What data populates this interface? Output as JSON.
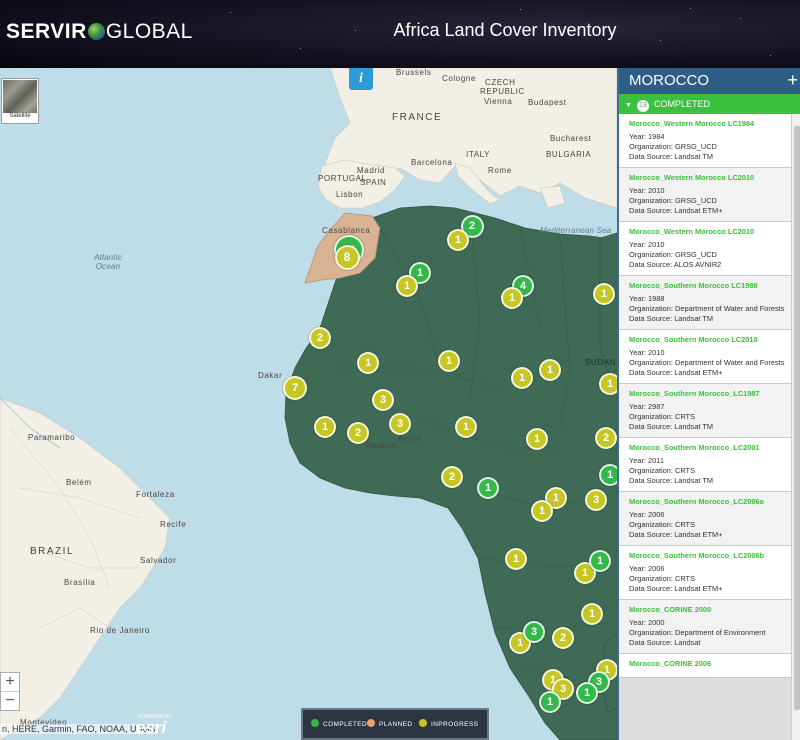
{
  "header": {
    "logo_part1": "SERVIR",
    "logo_part2": "GLOBAL",
    "title": "Africa Land Cover Inventory"
  },
  "map": {
    "satellite_label": "Satellite",
    "info_label": "i",
    "zoom_in": "+",
    "zoom_out": "−",
    "attribution": "ri, HERE, Garmin, FAO, NOAA, USGS",
    "powered_by": "POWERED BY",
    "esri_label": "esri",
    "labels": {
      "france": "FRANCE",
      "italy": "ITALY",
      "spain": "SPAIN",
      "portugal": "PORTUGAL",
      "bulgaria": "BULGARIA",
      "czech": "CZECH",
      "republic": "REPUBLIC",
      "brussels": "Brussels",
      "cologne": "Cologne",
      "vienna": "Vienna",
      "budapest": "Budapest",
      "bucharest": "Bucharest",
      "barcelona": "Barcelona",
      "madrid": "Madrid",
      "lisbon": "Lisbon",
      "casablanca": "Casablanca",
      "rome": "Rome",
      "dakar": "Dakar",
      "abidjan": "Abidjan",
      "accra": "Accra",
      "mediterranean": "Mediterranean Sea",
      "atlantic": "Atlantic Ocean",
      "brazil": "BRAZIL",
      "salvador": "Salvador",
      "fortaleza": "Fortaleza",
      "recife": "Recife",
      "belem": "Belém",
      "paramaribo": "Paramaribo",
      "brasilia": "Brasília",
      "rio": "Rio de Janeiro",
      "montevideo": "Montevideo",
      "sudan": "SUDAN"
    }
  },
  "clusters": [
    {
      "label": "13",
      "status": "completed"
    },
    {
      "label": "8",
      "status": "inprogress"
    },
    {
      "label": "2",
      "status": "completed"
    },
    {
      "label": "1",
      "status": "inprogress"
    },
    {
      "label": "1",
      "status": "completed"
    },
    {
      "label": "1",
      "status": "inprogress"
    },
    {
      "label": "4",
      "status": "completed"
    },
    {
      "label": "1",
      "status": "inprogress"
    },
    {
      "label": "1",
      "status": "inprogress"
    },
    {
      "label": "2",
      "status": "inprogress"
    },
    {
      "label": "1",
      "status": "inprogress"
    },
    {
      "label": "1",
      "status": "inprogress"
    },
    {
      "label": "1",
      "status": "inprogress"
    },
    {
      "label": "1",
      "status": "inprogress"
    },
    {
      "label": "7",
      "status": "inprogress"
    },
    {
      "label": "1",
      "status": "inprogress"
    },
    {
      "label": "3",
      "status": "inprogress"
    },
    {
      "label": "3",
      "status": "inprogress"
    },
    {
      "label": "1",
      "status": "inprogress"
    },
    {
      "label": "2",
      "status": "inprogress"
    },
    {
      "label": "1",
      "status": "inprogress"
    },
    {
      "label": "1",
      "status": "inprogress"
    },
    {
      "label": "2",
      "status": "inprogress"
    },
    {
      "label": "2",
      "status": "inprogress"
    },
    {
      "label": "1",
      "status": "completed"
    },
    {
      "label": "1",
      "status": "inprogress"
    },
    {
      "label": "3",
      "status": "inprogress"
    },
    {
      "label": "1",
      "status": "inprogress"
    },
    {
      "label": "1",
      "status": "completed"
    },
    {
      "label": "1",
      "status": "inprogress"
    },
    {
      "label": "1",
      "status": "inprogress"
    },
    {
      "label": "1",
      "status": "completed"
    },
    {
      "label": "1",
      "status": "inprogress"
    },
    {
      "label": "2",
      "status": "inprogress"
    },
    {
      "label": "1",
      "status": "inprogress"
    },
    {
      "label": "3",
      "status": "completed"
    },
    {
      "label": "1",
      "status": "inprogress"
    },
    {
      "label": "1",
      "status": "inprogress"
    },
    {
      "label": "3",
      "status": "completed"
    },
    {
      "label": "1",
      "status": "completed"
    },
    {
      "label": "3",
      "status": "inprogress"
    },
    {
      "label": "1",
      "status": "completed"
    }
  ],
  "legend": {
    "completed": "COMPLETED",
    "planned": "PLANNED",
    "inprogress": "INPROGRESS"
  },
  "colors": {
    "completed": "#35b84a",
    "planned": "#e8a06c",
    "inprogress": "#c6c625",
    "region": "#3f6b56",
    "morocco": "#d9b494"
  },
  "panel": {
    "country": "MOROCCO",
    "add_label": "+",
    "status_label": "COMPLETED",
    "status_count": "13",
    "items": [
      {
        "title": "Morocco_Western Morocco LC1984",
        "year": "Year: 1984",
        "org": "Organization: GRSG_UCD",
        "source": "Data Source: Landsat TM"
      },
      {
        "title": "Morocco_Western Morocco LC2010",
        "year": "Year: 2010",
        "org": "Organization: GRSG_UCD",
        "source": "Data Source: Landsat ETM+"
      },
      {
        "title": "Morocco_Western Morocco LC2010",
        "year": "Year: 2010",
        "org": "Organization: GRSG_UCD",
        "source": "Data Source: ALOS AVNIR2"
      },
      {
        "title": "Morocco_Southern Morocco LC1988",
        "year": "Year: 1988",
        "org": "Organization: Department of Water and Forests",
        "source": "Data Source: Landsat TM"
      },
      {
        "title": "Morocco_Southern Morocco LC2010",
        "year": "Year: 2010",
        "org": "Organization: Department of Water and Forests",
        "source": "Data Source: Landsat ETM+"
      },
      {
        "title": "Morocco_Southern Morocco_LC1987",
        "year": "Year: 2987",
        "org": "Organization: CRTS",
        "source": "Data Source: Landsat TM"
      },
      {
        "title": "Morocco_Southern Morocco_LC2001",
        "year": "Year: 2011",
        "org": "Organization: CRTS",
        "source": "Data Source: Landsat TM"
      },
      {
        "title": "Morocco_Southern Morocco_LC2006a",
        "year": "Year: 2006",
        "org": "Organization: CRTS",
        "source": "Data Source: Landsat ETM+"
      },
      {
        "title": "Morocco_Southern Morocco_LC2006b",
        "year": "Year: 2006",
        "org": "Organization: CRTS",
        "source": "Data Source: Landsat ETM+"
      },
      {
        "title": "Morocco_CORINE 2000",
        "year": "Year: 2000",
        "org": "Organization: Department of Environment",
        "source": "Data Source: Landsat"
      },
      {
        "title": "Morocco_CORINE 2006",
        "year": "",
        "org": "",
        "source": ""
      }
    ]
  }
}
